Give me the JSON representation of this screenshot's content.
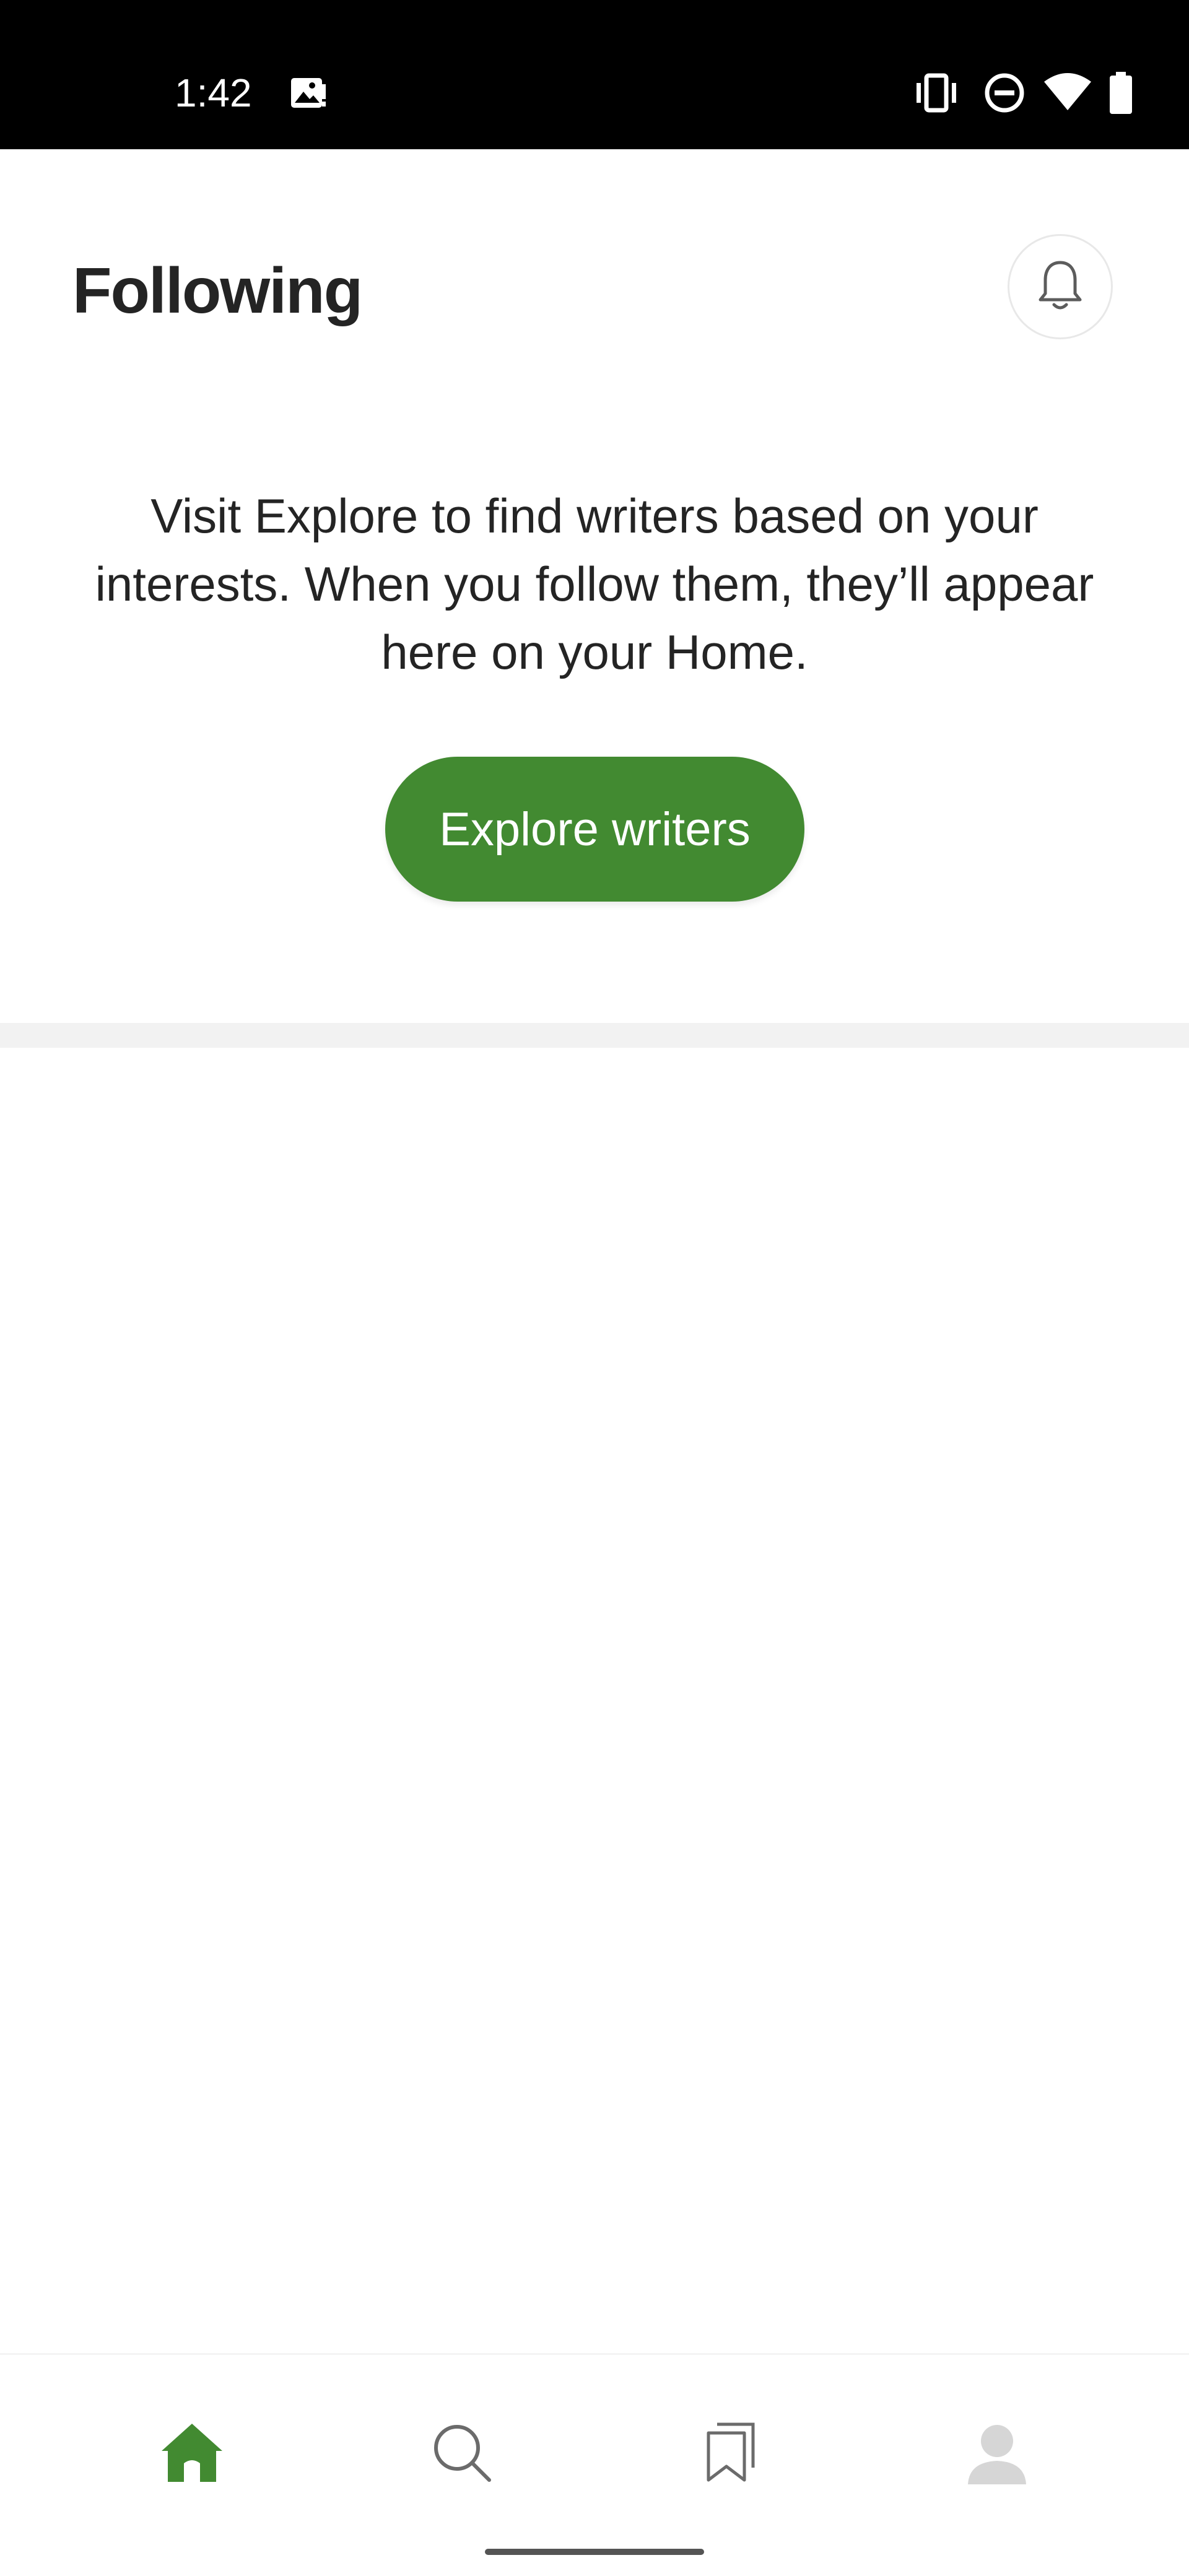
{
  "status_bar": {
    "time": "1:42",
    "icons": [
      "image-notification-icon",
      "vibrate-icon",
      "do-not-disturb-icon",
      "wifi-icon",
      "battery-icon"
    ]
  },
  "header": {
    "title": "Following",
    "notifications_icon": "bell-icon"
  },
  "empty_state": {
    "message": "Visit Explore to find writers based on your interests. When you follow them, they’ll appear here on your Home.",
    "button_label": "Explore writers"
  },
  "bottom_nav": {
    "items": [
      {
        "name": "home",
        "icon": "home-icon",
        "active": true
      },
      {
        "name": "search",
        "icon": "search-icon",
        "active": false
      },
      {
        "name": "bookmarks",
        "icon": "bookmarks-icon",
        "active": false
      },
      {
        "name": "profile",
        "icon": "profile-avatar-icon",
        "active": false
      }
    ]
  },
  "colors": {
    "accent": "#428a31",
    "text": "#242424",
    "icon_inactive": "#6b6b6b",
    "status_bar": "#000000"
  }
}
